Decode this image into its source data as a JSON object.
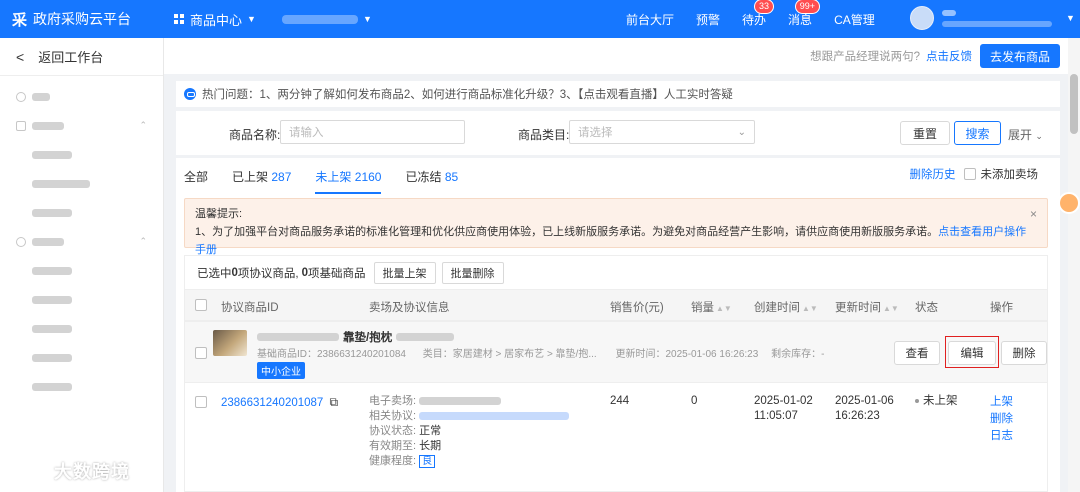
{
  "app": {
    "logo_mark": "采",
    "title": "政府采购云平台",
    "product_center": "商品中心"
  },
  "topnav": {
    "items": [
      {
        "label": "前台大厅"
      },
      {
        "label": "预警"
      },
      {
        "label": "待办",
        "badge": "33"
      },
      {
        "label": "消息",
        "badge": "99+"
      },
      {
        "label": "CA管理"
      }
    ]
  },
  "sidebar": {
    "back_label": "返回工作台"
  },
  "header": {
    "ask_text": "想跟产品经理说两句?",
    "feedback_link": "点击反馈",
    "publish_button": "去发布商品"
  },
  "hot_questions": "热门问题：1、两分钟了解如何发布商品2、如何进行商品标准化升级？3、【点击观看直播】人工实时答疑",
  "filter": {
    "name_label": "商品名称:",
    "name_placeholder": "请输入",
    "category_label": "商品类目:",
    "category_placeholder": "请选择",
    "reset": "重置",
    "search": "搜索",
    "expand": "展开"
  },
  "tabs": [
    {
      "label": "全部",
      "count": ""
    },
    {
      "label": "已上架",
      "count": "287"
    },
    {
      "label": "未上架",
      "count": "2160",
      "active": true
    },
    {
      "label": "已冻结",
      "count": "85"
    }
  ],
  "tabs_right": {
    "history": "删除历史",
    "not_added": "未添加卖场"
  },
  "tip": {
    "title": "温馨提示:",
    "body": "1、为了加强平台对商品服务承诺的标准化管理和优化供应商使用体验，已上线新版服务承诺。为避免对商品经营产生影响，请供应商使用新版服务承诺。",
    "link": "点击查看用户操作手册",
    "close": "×"
  },
  "batch": {
    "prefix": "已选中",
    "selected": "0",
    "mid": "项协议商品,",
    "base": "0",
    "suffix": "项基础商品",
    "up_button": "批量上架",
    "delete_button": "批量删除"
  },
  "table": {
    "headers": [
      "协议商品ID",
      "卖场及协议信息",
      "销售价(元)",
      "销量",
      "创建时间",
      "更新时间",
      "状态",
      "操作"
    ]
  },
  "group": {
    "title": "靠垫/抱枕",
    "base_id": "基础商品ID：2386631240201084",
    "category": "类目：家居建材 > 居家布艺 > 靠垫/抱...",
    "updated": "更新时间：2025-01-06 16:26:23",
    "stock": "剩余库存：-",
    "tag": "中小企业",
    "view": "查看",
    "edit": "编辑",
    "delete": "删除"
  },
  "row": {
    "id": "2386631240201087",
    "mall_label": "电子卖场:",
    "protocol_label": "相关协议:",
    "status_label": "协议状态:",
    "status_value": "正常",
    "valid_label": "有效期至:",
    "valid_value": "长期",
    "health_label": "健康程度:",
    "health_value": "良",
    "price": "244",
    "sales": "0",
    "created_date": "2025-01-02",
    "created_time": "11:05:07",
    "updated_date": "2025-01-06",
    "updated_time": "16:26:23",
    "state": "未上架",
    "op_up": "上架",
    "op_delete": "删除",
    "op_log": "日志"
  },
  "watermark": "大数跨境",
  "colors": {
    "primary": "#1677ff",
    "badge": "#ff4d4f",
    "tip_bg": "#fdf1e9",
    "highlight_box": "#e02020"
  }
}
